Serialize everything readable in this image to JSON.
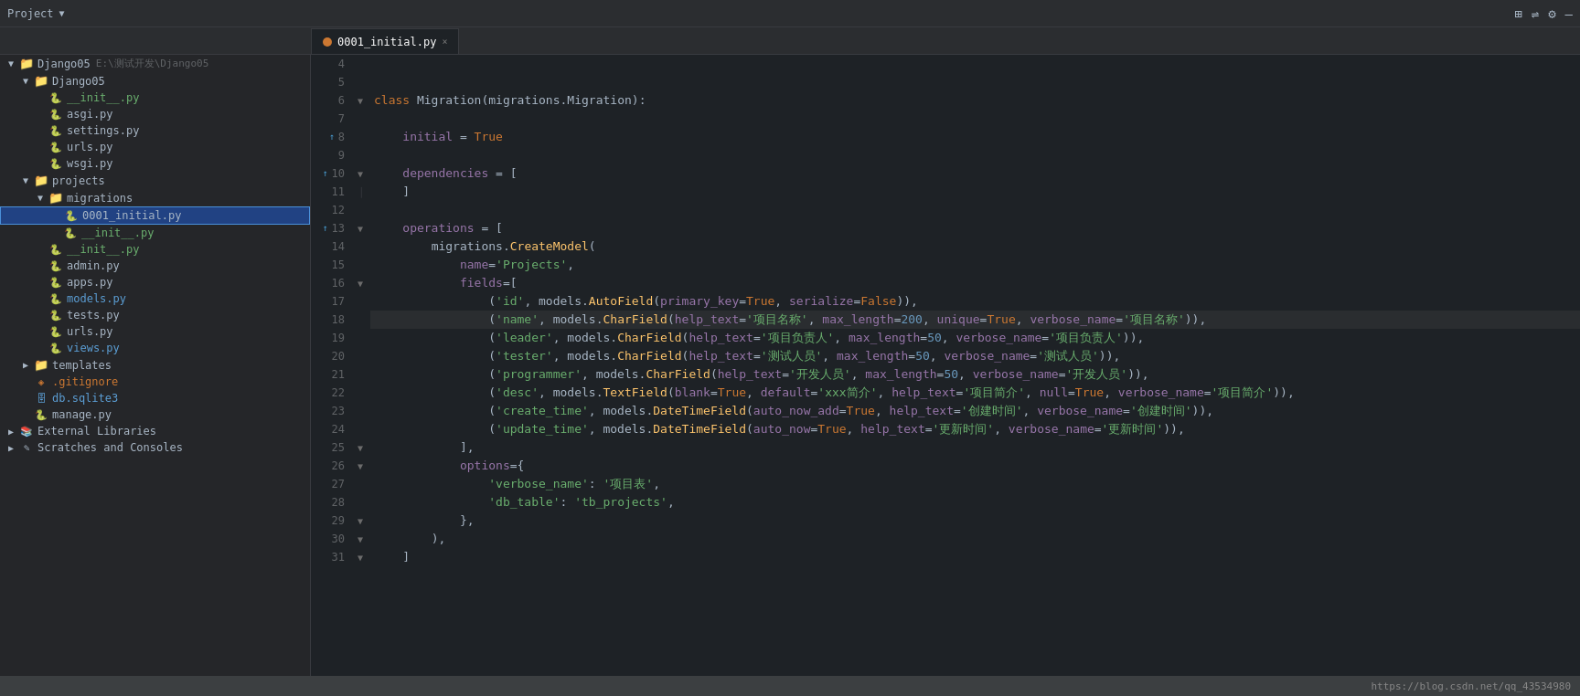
{
  "titlebar": {
    "project_label": "Project",
    "dropdown_arrow": "▼"
  },
  "toolbar_icons": [
    "⚙",
    "≡",
    "⚙",
    "—"
  ],
  "tab": {
    "name": "0001_initial.py",
    "close": "×"
  },
  "sidebar": {
    "root": {
      "label": "Django05",
      "path": "E:\\测试开发\\Django05"
    },
    "items": [
      {
        "id": "django05-root",
        "label": "Django05",
        "indent": 0,
        "type": "folder",
        "expanded": true
      },
      {
        "id": "django05-sub",
        "label": "Django05",
        "indent": 1,
        "type": "folder",
        "expanded": true
      },
      {
        "id": "__init__-top",
        "label": "__init__.py",
        "indent": 2,
        "type": "py"
      },
      {
        "id": "asgi",
        "label": "asgi.py",
        "indent": 2,
        "type": "py"
      },
      {
        "id": "settings",
        "label": "settings.py",
        "indent": 2,
        "type": "py"
      },
      {
        "id": "urls-top",
        "label": "urls.py",
        "indent": 2,
        "type": "py"
      },
      {
        "id": "wsgi",
        "label": "wsgi.py",
        "indent": 2,
        "type": "py"
      },
      {
        "id": "projects",
        "label": "projects",
        "indent": 1,
        "type": "folder",
        "expanded": true
      },
      {
        "id": "migrations",
        "label": "migrations",
        "indent": 2,
        "type": "folder",
        "expanded": true
      },
      {
        "id": "0001_initial",
        "label": "0001_initial.py",
        "indent": 3,
        "type": "py",
        "selected": true
      },
      {
        "id": "__init__-mig",
        "label": "__init__.py",
        "indent": 3,
        "type": "py"
      },
      {
        "id": "__init__-proj",
        "label": "__init__.py",
        "indent": 2,
        "type": "py"
      },
      {
        "id": "admin",
        "label": "admin.py",
        "indent": 2,
        "type": "py"
      },
      {
        "id": "apps",
        "label": "apps.py",
        "indent": 2,
        "type": "py"
      },
      {
        "id": "models",
        "label": "models.py",
        "indent": 2,
        "type": "py"
      },
      {
        "id": "tests",
        "label": "tests.py",
        "indent": 2,
        "type": "py"
      },
      {
        "id": "urls",
        "label": "urls.py",
        "indent": 2,
        "type": "py"
      },
      {
        "id": "views",
        "label": "views.py",
        "indent": 2,
        "type": "py"
      },
      {
        "id": "templates",
        "label": "templates",
        "indent": 1,
        "type": "folder",
        "expanded": false
      },
      {
        "id": "gitignore",
        "label": ".gitignore",
        "indent": 1,
        "type": "git"
      },
      {
        "id": "db-sqlite3",
        "label": "db.sqlite3",
        "indent": 1,
        "type": "db"
      },
      {
        "id": "manage",
        "label": "manage.py",
        "indent": 1,
        "type": "py"
      },
      {
        "id": "ext-lib",
        "label": "External Libraries",
        "indent": 0,
        "type": "lib"
      },
      {
        "id": "scratches",
        "label": "Scratches and Consoles",
        "indent": 0,
        "type": "scratch"
      }
    ]
  },
  "code": {
    "lines": [
      {
        "num": 4,
        "content": "",
        "gutters": []
      },
      {
        "num": 5,
        "content": "",
        "gutters": []
      },
      {
        "num": 6,
        "content": "class Migration(migrations.Migration):",
        "gutters": []
      },
      {
        "num": 7,
        "content": "",
        "gutters": []
      },
      {
        "num": 8,
        "content": "    initial = True",
        "gutters": [
          "bookmark"
        ]
      },
      {
        "num": 9,
        "content": "",
        "gutters": []
      },
      {
        "num": 10,
        "content": "    dependencies = [",
        "gutters": [
          "bookmark"
        ]
      },
      {
        "num": 11,
        "content": "    ]",
        "gutters": []
      },
      {
        "num": 12,
        "content": "",
        "gutters": []
      },
      {
        "num": 13,
        "content": "    operations = [",
        "gutters": [
          "bookmark"
        ]
      },
      {
        "num": 14,
        "content": "        migrations.CreateModel(",
        "gutters": []
      },
      {
        "num": 15,
        "content": "            name='Projects',",
        "gutters": []
      },
      {
        "num": 16,
        "content": "            fields=[",
        "gutters": []
      },
      {
        "num": 17,
        "content": "                ('id', models.AutoField(primary_key=True, serialize=False)),",
        "gutters": []
      },
      {
        "num": 18,
        "content": "                ('name', models.CharField(help_text='项目名称', max_length=200, unique=True, verbose_name='项目名称')),",
        "gutters": [],
        "highlight": true
      },
      {
        "num": 19,
        "content": "                ('leader', models.CharField(help_text='项目负责人', max_length=50, verbose_name='项目负责人')),",
        "gutters": []
      },
      {
        "num": 20,
        "content": "                ('tester', models.CharField(help_text='测试人员', max_length=50, verbose_name='测试人员')),",
        "gutters": []
      },
      {
        "num": 21,
        "content": "                ('programmer', models.CharField(help_text='开发人员', max_length=50, verbose_name='开发人员')),",
        "gutters": []
      },
      {
        "num": 22,
        "content": "                ('desc', models.TextField(blank=True, default='xxx简介', help_text='项目简介', null=True, verbose_name='项目简介')),",
        "gutters": []
      },
      {
        "num": 23,
        "content": "                ('create_time', models.DateTimeField(auto_now_add=True, help_text='创建时间', verbose_name='创建时间')),",
        "gutters": []
      },
      {
        "num": 24,
        "content": "                ('update_time', models.DateTimeField(auto_now=True, help_text='更新时间', verbose_name='更新时间')),",
        "gutters": []
      },
      {
        "num": 25,
        "content": "            ],",
        "gutters": []
      },
      {
        "num": 26,
        "content": "            options={",
        "gutters": []
      },
      {
        "num": 27,
        "content": "                'verbose_name': '项目表',",
        "gutters": []
      },
      {
        "num": 28,
        "content": "                'db_table': 'tb_projects',",
        "gutters": []
      },
      {
        "num": 29,
        "content": "            },",
        "gutters": []
      },
      {
        "num": 30,
        "content": "        ),",
        "gutters": []
      },
      {
        "num": 31,
        "content": "    ]",
        "gutters": []
      }
    ]
  },
  "status_bar": {
    "url": "https://blog.csdn.net/qq_43534980"
  }
}
